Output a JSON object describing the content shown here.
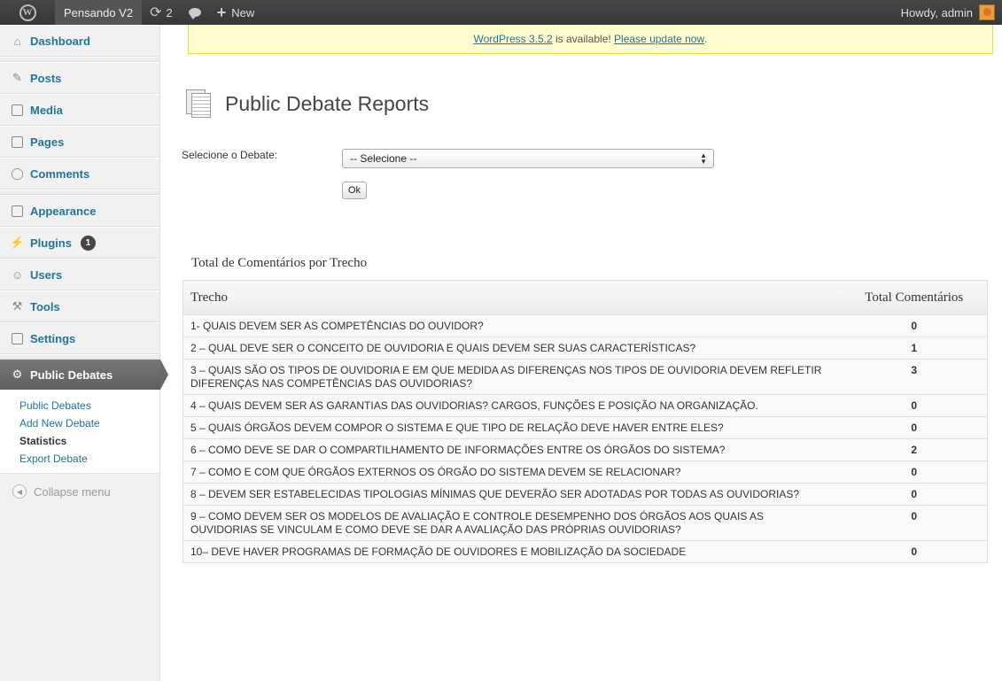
{
  "adminbar": {
    "site_name": "Pensando V2",
    "updates_count": "2",
    "new_label": "New",
    "greeting": "Howdy, admin"
  },
  "sidebar": {
    "items": [
      {
        "label": "Dashboard",
        "icon": "home-icon"
      },
      {
        "label": "Posts",
        "icon": "pin-icon"
      },
      {
        "label": "Media",
        "icon": "media-icon"
      },
      {
        "label": "Pages",
        "icon": "pages-icon"
      },
      {
        "label": "Comments",
        "icon": "comment-icon"
      },
      {
        "label": "Appearance",
        "icon": "appearance-icon"
      },
      {
        "label": "Plugins",
        "icon": "plugin-icon",
        "badge": "1"
      },
      {
        "label": "Users",
        "icon": "users-icon"
      },
      {
        "label": "Tools",
        "icon": "tools-icon"
      },
      {
        "label": "Settings",
        "icon": "settings-icon"
      }
    ],
    "active": {
      "label": "Public Debates",
      "icon": "gear-icon"
    },
    "submenu": [
      {
        "label": "Public Debates"
      },
      {
        "label": "Add New Debate"
      },
      {
        "label": "Statistics"
      },
      {
        "label": "Export Debate"
      }
    ],
    "collapse_label": "Collapse menu"
  },
  "notice": {
    "version_link": "WordPress 3.5.2",
    "middle": " is available! ",
    "update_link": "Please update now",
    "end": "."
  },
  "page": {
    "title": "Public Debate Reports",
    "filter_label": "Selecione o Debate:",
    "select_value": "-- Selecione --",
    "ok_label": "Ok"
  },
  "report": {
    "caption": "Total de Comentários por Trecho",
    "col_trecho": "Trecho",
    "col_total": "Total Comentários",
    "rows": [
      {
        "trecho": "1- QUAIS DEVEM SER AS COMPETÊNCIAS DO OUVIDOR?",
        "total": "0"
      },
      {
        "trecho": "2 – QUAL DEVE SER O CONCEITO DE OUVIDORIA E QUAIS DEVEM SER SUAS CARACTERÍSTICAS?",
        "total": "1"
      },
      {
        "trecho": "3 – QUAIS SÃO OS TIPOS DE OUVIDORIA E EM QUE MEDIDA AS DIFERENÇAS NOS TIPOS DE OUVIDORIA DEVEM REFLETIR DIFERENÇAS NAS COMPETÊNCIAS DAS OUVIDORIAS?",
        "total": "3"
      },
      {
        "trecho": "4 – QUAIS DEVEM SER AS GARANTIAS DAS OUVIDORIAS? CARGOS, FUNÇÕES E POSIÇÃO NA ORGANIZAÇÃO.",
        "total": "0"
      },
      {
        "trecho": "5 – QUAIS ÓRGÃOS DEVEM COMPOR O SISTEMA E QUE TIPO DE RELAÇÃO DEVE HAVER ENTRE ELES?",
        "total": "0"
      },
      {
        "trecho": "6 – COMO DEVE SE DAR O COMPARTILHAMENTO DE INFORMAÇÕES ENTRE OS ÓRGÃOS DO SISTEMA?",
        "total": "2"
      },
      {
        "trecho": "7 – COMO E COM QUE ÓRGÃOS EXTERNOS OS ÓRGÃO DO SISTEMA DEVEM SE RELACIONAR?",
        "total": "0"
      },
      {
        "trecho": "8 – DEVEM SER ESTABELECIDAS TIPOLOGIAS MÍNIMAS QUE DEVERÃO SER ADOTADAS POR TODAS AS OUVIDORIAS?",
        "total": "0"
      },
      {
        "trecho": "9 – COMO DEVEM SER OS MODELOS DE AVALIAÇÃO E CONTROLE DESEMPENHO DOS ÓRGÃOS AOS QUAIS AS OUVIDORIAS SE VINCULAM E COMO DEVE SE DAR A AVALIAÇÃO DAS PRÓPRIAS OUVIDORIAS?",
        "total": "0"
      },
      {
        "trecho": "10– DEVE HAVER PROGRAMAS DE FORMAÇÃO DE OUVIDORES E MOBILIZAÇÃO DA SOCIEDADE",
        "total": "0"
      }
    ]
  }
}
